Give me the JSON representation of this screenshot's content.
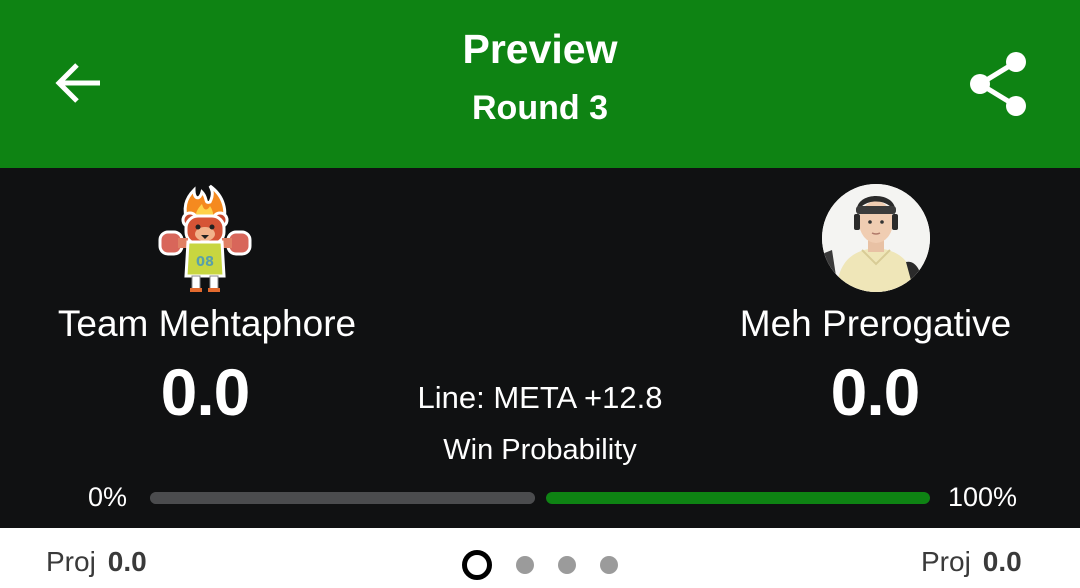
{
  "header": {
    "title": "Preview",
    "subtitle": "Round 3",
    "back_icon": "arrow-left-icon",
    "share_icon": "share-icon",
    "background_color": "#0e8313"
  },
  "matchup": {
    "team_left": {
      "name": "Team Mehtaphore",
      "score": "0.0",
      "avatar_icon": "cartoon-bear-mascot-avatar",
      "avatar_text": "08"
    },
    "team_right": {
      "name": "Meh Prerogative",
      "score": "0.0",
      "avatar_icon": "person-headgear-photo-avatar"
    },
    "line": "Line: META +12.8",
    "win_probability_label": "Win Probability",
    "win_probability": {
      "left_label": "0%",
      "right_label": "100%",
      "left_value": 0,
      "right_value": 1,
      "left_color": "#4b4c4e",
      "right_color": "#0e8313"
    }
  },
  "footer": {
    "proj_left_label": "Proj",
    "proj_left_value": "0.0",
    "proj_right_label": "Proj",
    "proj_right_value": "0.0",
    "page_indicator": {
      "total": 4,
      "active": 1
    }
  }
}
